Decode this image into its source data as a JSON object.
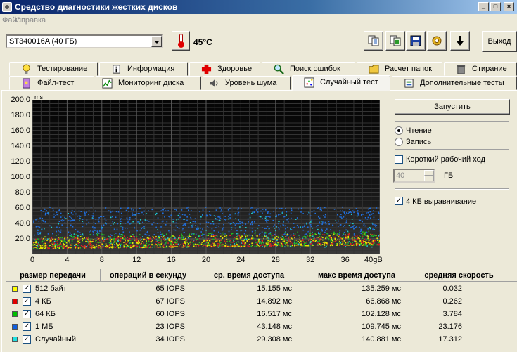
{
  "window": {
    "title": "Средство диагностики жестких дисков",
    "min_glyph": "_",
    "max_glyph": "□",
    "close_glyph": "×"
  },
  "menu": [
    "Файл",
    "Справка"
  ],
  "drive_select": {
    "value": "ST340016A (40 ГБ)"
  },
  "temperature": "45°C",
  "toolbar": {
    "icons": [
      "copy-icon",
      "copy-alt-icon",
      "save-icon",
      "settings-icon",
      "arrow-down-icon"
    ],
    "exit_label": "Выход"
  },
  "tabs_row1": [
    {
      "label": "Тестирование",
      "icon": "lightbulb-icon"
    },
    {
      "label": "Информация",
      "icon": "info-icon"
    },
    {
      "label": "Здоровье",
      "icon": "red-cross-icon"
    },
    {
      "label": "Поиск ошибок",
      "icon": "magnifier-icon"
    },
    {
      "label": "Расчет папок",
      "icon": "folder-icon"
    },
    {
      "label": "Стирание",
      "icon": "trash-icon"
    }
  ],
  "tabs_row2": [
    {
      "label": "Файл-тест",
      "icon": "file-test-icon"
    },
    {
      "label": "Мониторинг диска",
      "icon": "monitor-chart-icon"
    },
    {
      "label": "Уровень шума",
      "icon": "speaker-icon"
    },
    {
      "label": "Случайный тест",
      "icon": "random-test-icon",
      "active": true
    },
    {
      "label": "Дополнительные тесты",
      "icon": "extra-tests-icon"
    }
  ],
  "controls": {
    "run_label": "Запустить",
    "read_label": "Чтение",
    "write_label": "Запись",
    "mode": "read",
    "short_stroke_label": "Короткий рабочий ход",
    "short_stroke_checked": false,
    "short_stroke_value": "40",
    "short_stroke_unit": "ГБ",
    "align_label": "4 КБ выравнивание",
    "align_checked": true
  },
  "chart_data": {
    "type": "scatter",
    "ylabel": "ms",
    "xlim": [
      0,
      40
    ],
    "ylim": [
      0,
      200
    ],
    "x_ticks": [
      "0",
      "4",
      "8",
      "12",
      "16",
      "20",
      "24",
      "28",
      "32",
      "36",
      "40gB"
    ],
    "y_ticks": [
      "200.0",
      "180.0",
      "160.0",
      "140.0",
      "120.0",
      "100.0",
      "80.0",
      "60.0",
      "40.0",
      "20.0"
    ],
    "grid": true,
    "series": [
      {
        "name": "512 байт",
        "color": "#e8e800",
        "approx_range_ms": [
          8,
          23
        ]
      },
      {
        "name": "4 КБ",
        "color": "#e02020",
        "approx_range_ms": [
          8,
          23
        ]
      },
      {
        "name": "64 КБ",
        "color": "#20c020",
        "approx_range_ms": [
          8,
          26
        ]
      },
      {
        "name": "1 МБ",
        "color": "#2070e0",
        "approx_range_ms": [
          25,
          62
        ]
      },
      {
        "name": "Случайный",
        "color": "#20d0d0",
        "approx_range_ms": [
          10,
          55
        ]
      }
    ]
  },
  "table": {
    "headers": [
      "размер передачи",
      "операций в секунду",
      "ср. время доступа",
      "макс время доступа",
      "средняя скорость"
    ],
    "rows": [
      {
        "color": "#ffff00",
        "checked": true,
        "size": "512 байт",
        "iops": "65 IOPS",
        "avg": "15.155 мс",
        "max": "135.259 мс",
        "speed": "0.032"
      },
      {
        "color": "#e00000",
        "checked": true,
        "size": "4 КБ",
        "iops": "67 IOPS",
        "avg": "14.892 мс",
        "max": "66.868 мс",
        "speed": "0.262"
      },
      {
        "color": "#00c000",
        "checked": true,
        "size": "64 КБ",
        "iops": "60 IOPS",
        "avg": "16.517 мс",
        "max": "102.128 мс",
        "speed": "3.784"
      },
      {
        "color": "#1060e0",
        "checked": true,
        "size": "1 МБ",
        "iops": "23 IOPS",
        "avg": "43.148 мс",
        "max": "109.745 мс",
        "speed": "23.176"
      },
      {
        "color": "#20e0e0",
        "checked": true,
        "size": "Случайный",
        "iops": "34 IOPS",
        "avg": "29.308 мс",
        "max": "140.881 мс",
        "speed": "17.312"
      }
    ]
  }
}
